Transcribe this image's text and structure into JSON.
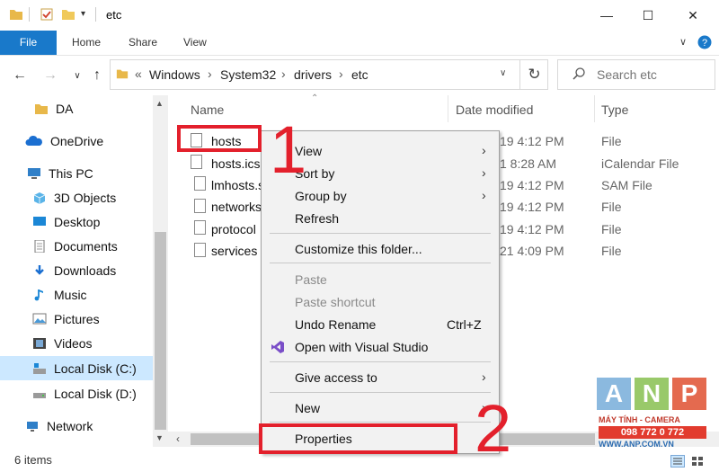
{
  "window": {
    "title": "etc"
  },
  "ribbon": {
    "tabs": [
      "File",
      "Home",
      "Share",
      "View"
    ]
  },
  "address": {
    "root_chevron": "«",
    "crumbs": [
      "Windows",
      "System32",
      "drivers",
      "etc"
    ]
  },
  "search": {
    "placeholder": "Search etc"
  },
  "nav": {
    "items": [
      "DA",
      "OneDrive",
      "This PC",
      "3D Objects",
      "Desktop",
      "Documents",
      "Downloads",
      "Music",
      "Pictures",
      "Videos",
      "Local Disk (C:)",
      "Local Disk (D:)",
      "Network"
    ]
  },
  "columns": {
    "name": "Name",
    "date": "Date modified",
    "type": "Type"
  },
  "files": [
    {
      "name": "hosts",
      "date": "19 4:12 PM",
      "type": "File"
    },
    {
      "name": "hosts.ics",
      "date": "1 8:28 AM",
      "type": "iCalendar File"
    },
    {
      "name": "lmhosts.s",
      "date": "19 4:12 PM",
      "type": "SAM File"
    },
    {
      "name": "networks",
      "date": "19 4:12 PM",
      "type": "File"
    },
    {
      "name": "protocol",
      "date": "19 4:12 PM",
      "type": "File"
    },
    {
      "name": "services",
      "date": "21 4:09 PM",
      "type": "File"
    }
  ],
  "context_menu": {
    "view": "View",
    "sort_by": "Sort by",
    "group_by": "Group by",
    "refresh": "Refresh",
    "customize": "Customize this folder...",
    "paste": "Paste",
    "paste_shortcut": "Paste shortcut",
    "undo_rename": "Undo Rename",
    "undo_shortcut": "Ctrl+Z",
    "open_vs": "Open with Visual Studio",
    "give_access": "Give access to",
    "new": "New",
    "properties": "Properties"
  },
  "status": {
    "items": "6 items"
  },
  "annotations": {
    "step1": "1",
    "step2": "2"
  },
  "watermark": {
    "letters": [
      "A",
      "N",
      "P"
    ],
    "tagline": "MÁY TÍNH - CAMERA",
    "phone": "098 772 0 772",
    "site": "WWW.ANP.COM.VN"
  },
  "colors": {
    "accent": "#1979ca",
    "annotation_red": "#e3202c",
    "selection": "#cce8ff"
  }
}
